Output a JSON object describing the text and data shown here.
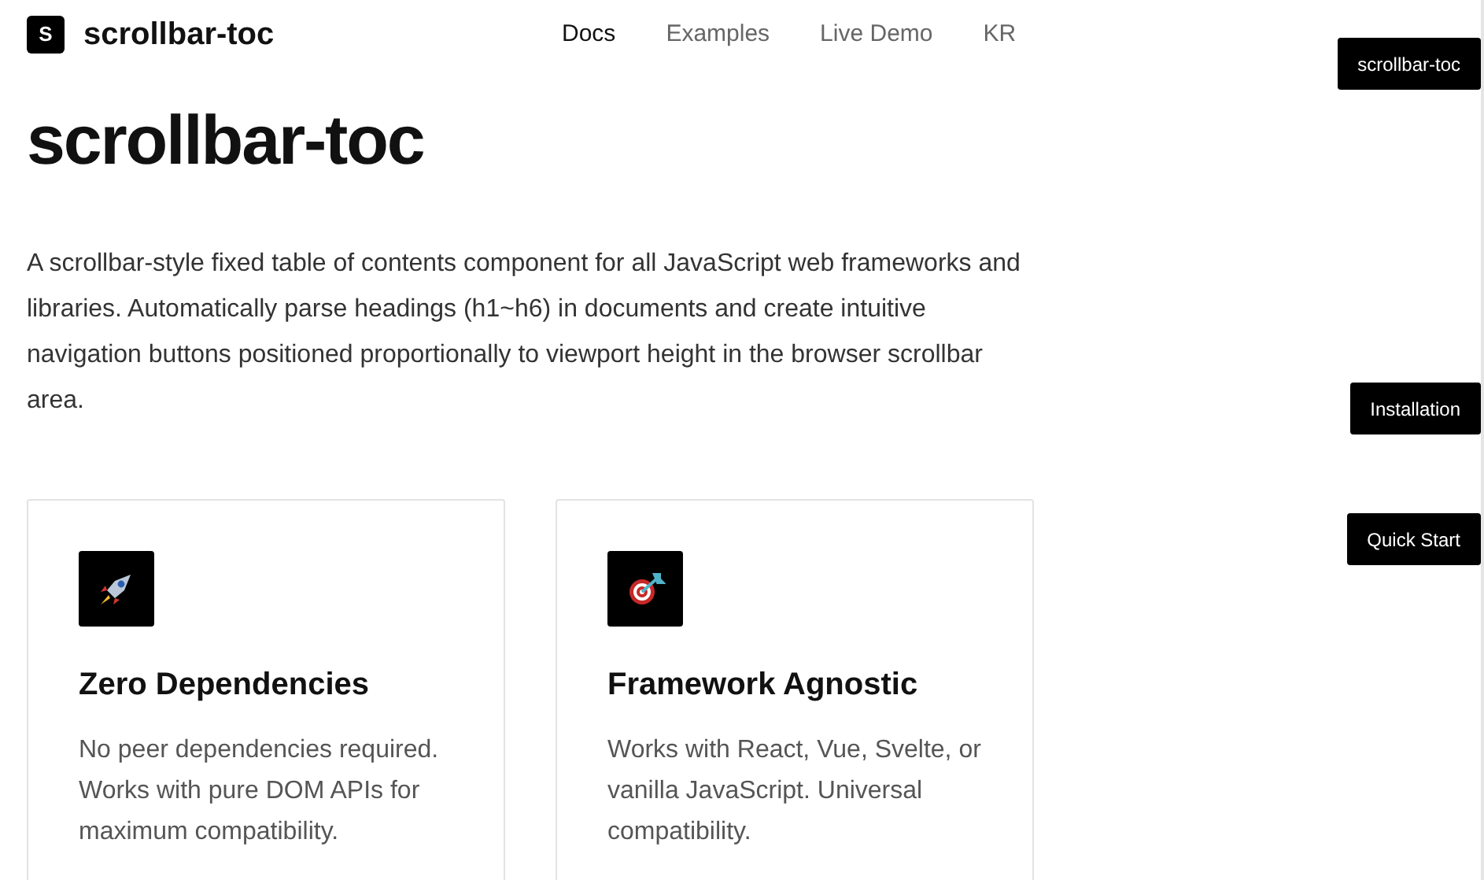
{
  "header": {
    "logo_letter": "S",
    "brand": "scrollbar-toc",
    "nav": [
      {
        "label": "Docs",
        "selected": true
      },
      {
        "label": "Examples",
        "selected": false
      },
      {
        "label": "Live Demo",
        "selected": false
      },
      {
        "label": "KR",
        "selected": false
      }
    ]
  },
  "title": "scrollbar-toc",
  "intro": "A scrollbar-style fixed table of contents component for all JavaScript web frameworks and libraries. Automatically parse headings (h1~h6) in documents and create intuitive navigation buttons positioned proportionally to viewport height in the browser scrollbar area.",
  "features": [
    {
      "title": "Zero Dependencies",
      "description": "No peer dependencies required. Works with pure DOM APIs for maximum compatibility."
    },
    {
      "title": "Framework Agnostic",
      "description": "Works with React, Vue, Svelte, or vanilla JavaScript. Universal compatibility."
    }
  ],
  "toc": [
    "scrollbar-toc",
    "Installation",
    "Quick Start"
  ]
}
